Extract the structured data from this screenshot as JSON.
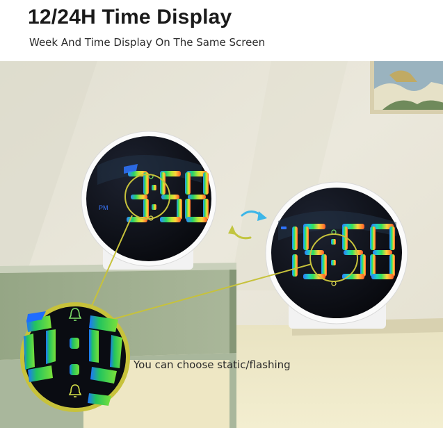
{
  "header": {
    "title": "12/24H Time Display",
    "subtitle": "Week And Time Display On The Same Screen"
  },
  "clock_left": {
    "time": "3:58",
    "period": "PM"
  },
  "clock_right": {
    "time": "15:58"
  },
  "zoom": {
    "caption": "You can choose static/flashing"
  },
  "colors": {
    "wall": "#e9e6d8",
    "shelf": "#9fae8e",
    "floor": "#efe8c8",
    "highlight": "#c7c23b",
    "clock_face": "#0b0d14"
  }
}
